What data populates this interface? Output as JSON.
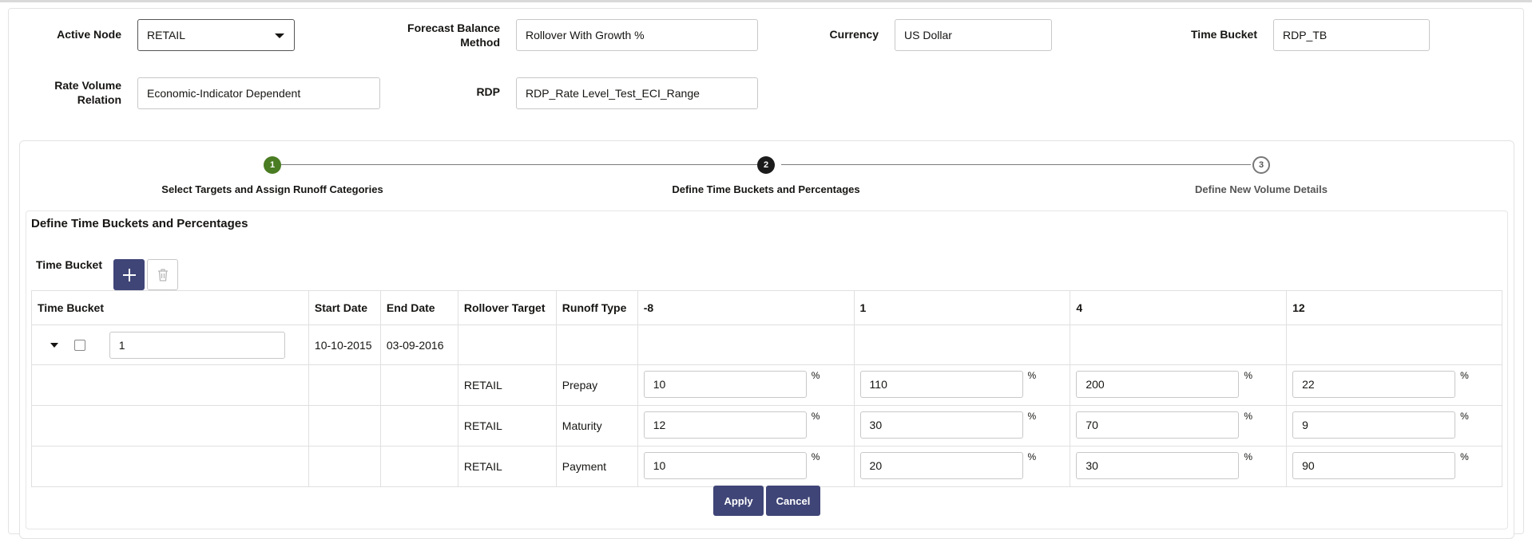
{
  "form": {
    "active_node": {
      "label": "Active Node",
      "value": "RETAIL"
    },
    "forecast_balance_method": {
      "label": "Forecast Balance Method",
      "value": "Rollover With Growth %"
    },
    "currency": {
      "label": "Currency",
      "value": "US Dollar"
    },
    "time_bucket": {
      "label": "Time Bucket",
      "value": "RDP_TB"
    },
    "rate_volume_relation": {
      "label": "Rate Volume Relation",
      "value": "Economic-Indicator Dependent"
    },
    "rdp": {
      "label": "RDP",
      "value": "RDP_Rate Level_Test_ECI_Range"
    }
  },
  "train": {
    "steps": [
      {
        "number": "1",
        "label": "Select Targets and Assign Runoff Categories",
        "state": "done"
      },
      {
        "number": "2",
        "label": "Define Time Buckets and Percentages",
        "state": "active"
      },
      {
        "number": "3",
        "label": "Define New Volume Details",
        "state": "todo"
      }
    ]
  },
  "section": {
    "title": "Define Time Buckets and Percentages",
    "time_bucket_label": "Time Bucket",
    "add_icon": "plus-icon",
    "delete_icon": "trash-icon"
  },
  "table": {
    "headers": [
      "Time Bucket",
      "Start Date",
      "End Date",
      "Rollover Target",
      "Runoff Type",
      "-8",
      "1",
      "4",
      "12"
    ],
    "bucket_row": {
      "time_bucket": "1",
      "start_date": "10-10-2015",
      "end_date": "03-09-2016"
    },
    "percent_sign": "%",
    "rows": [
      {
        "target": "RETAIL",
        "runoff": "Prepay",
        "values": [
          "10",
          "110",
          "200",
          "22"
        ]
      },
      {
        "target": "RETAIL",
        "runoff": "Maturity",
        "values": [
          "12",
          "30",
          "70",
          "9"
        ]
      },
      {
        "target": "RETAIL",
        "runoff": "Payment",
        "values": [
          "10",
          "20",
          "30",
          "90"
        ]
      }
    ]
  },
  "actions": {
    "apply": "Apply",
    "cancel": "Cancel"
  },
  "colors": {
    "primary_button": "#3f4577",
    "step_done": "#4a7c23",
    "step_active": "#1b1b1b"
  }
}
